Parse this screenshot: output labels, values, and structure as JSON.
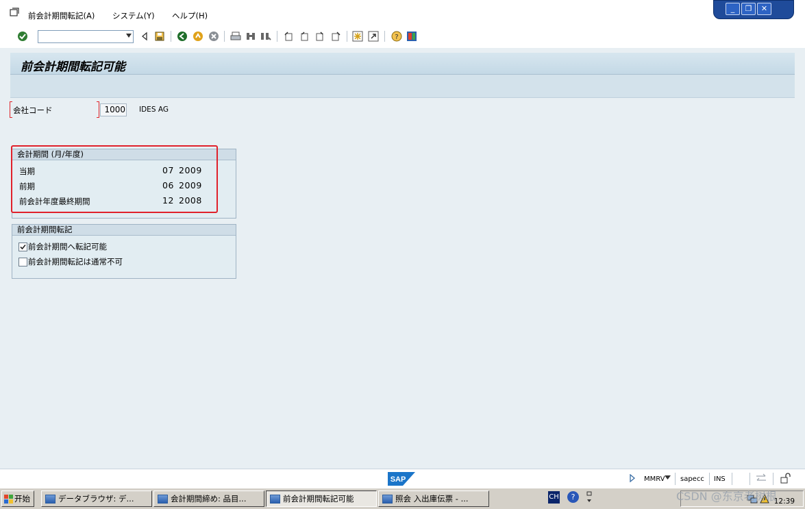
{
  "menubar": {
    "items": [
      {
        "label": "前会計期間転記(A)"
      },
      {
        "label": "システム(Y)"
      },
      {
        "label": "ヘルプ(H)"
      }
    ]
  },
  "toolbar": {
    "command_field_value": "",
    "icons": [
      "check-icon",
      "back-arrow-icon",
      "save-icon",
      "back-icon",
      "exit-icon",
      "cancel-icon",
      "print-icon",
      "find-icon",
      "find-next-icon",
      "first-page-icon",
      "prev-page-icon",
      "next-page-icon",
      "last-page-icon",
      "new-session-icon",
      "shortcut-icon",
      "help-icon",
      "customize-layout-icon"
    ]
  },
  "screen": {
    "title": "前会計期間転記可能"
  },
  "company": {
    "label": "会社コード",
    "code": "1000",
    "name": "IDES AG"
  },
  "period_group": {
    "header": "会計期間 (月/年度)",
    "rows": [
      {
        "label": "当期",
        "month": "07",
        "year": "2009"
      },
      {
        "label": "前期",
        "month": "06",
        "year": "2009"
      },
      {
        "label": "前会計年度最終期間",
        "month": "12",
        "year": "2008"
      }
    ]
  },
  "posting_group": {
    "header": "前会計期間転記",
    "options": [
      {
        "label": "前会計期間へ転記可能",
        "checked": true
      },
      {
        "label": "前会計期間転記は通常不可",
        "checked": false
      }
    ]
  },
  "statusbar": {
    "logo": "SAP",
    "transaction": "MMRV",
    "system": "sapecc",
    "mode": "INS"
  },
  "taskbar": {
    "start_label": "开始",
    "tasks": [
      {
        "label": "データブラウザ: デ...",
        "active": false
      },
      {
        "label": "会計期間締め: 品目...",
        "active": false
      },
      {
        "label": "前会計期間転記可能",
        "active": true
      },
      {
        "label": "照会 入出庫伝票 - ...",
        "active": false
      }
    ],
    "lang": "CH",
    "clock": "12:39"
  },
  "watermark": "CSDN @东京老树根"
}
